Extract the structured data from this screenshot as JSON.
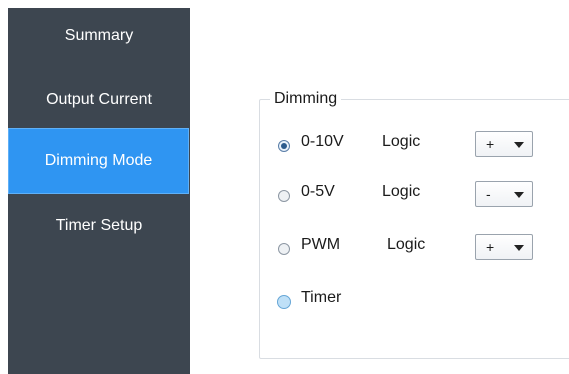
{
  "sidebar": {
    "items": [
      {
        "label": "Summary"
      },
      {
        "label": "Output Current"
      },
      {
        "label": "Dimming Mode"
      },
      {
        "label": "Timer Setup"
      }
    ]
  },
  "dimming": {
    "title": "Dimming",
    "logic_label": "Logic",
    "options": [
      {
        "label": "0-10V",
        "checked": true,
        "logic_value": "+"
      },
      {
        "label": "0-5V",
        "checked": false,
        "logic_value": "-"
      },
      {
        "label": "PWM",
        "checked": false,
        "logic_value": "+"
      },
      {
        "label": "Timer",
        "checked": false
      }
    ]
  },
  "colors": {
    "sidebar_bg": "#3d4650",
    "active_bg": "#2f95f2"
  },
  "icons": {
    "dropdown": "chevron-down-icon"
  }
}
